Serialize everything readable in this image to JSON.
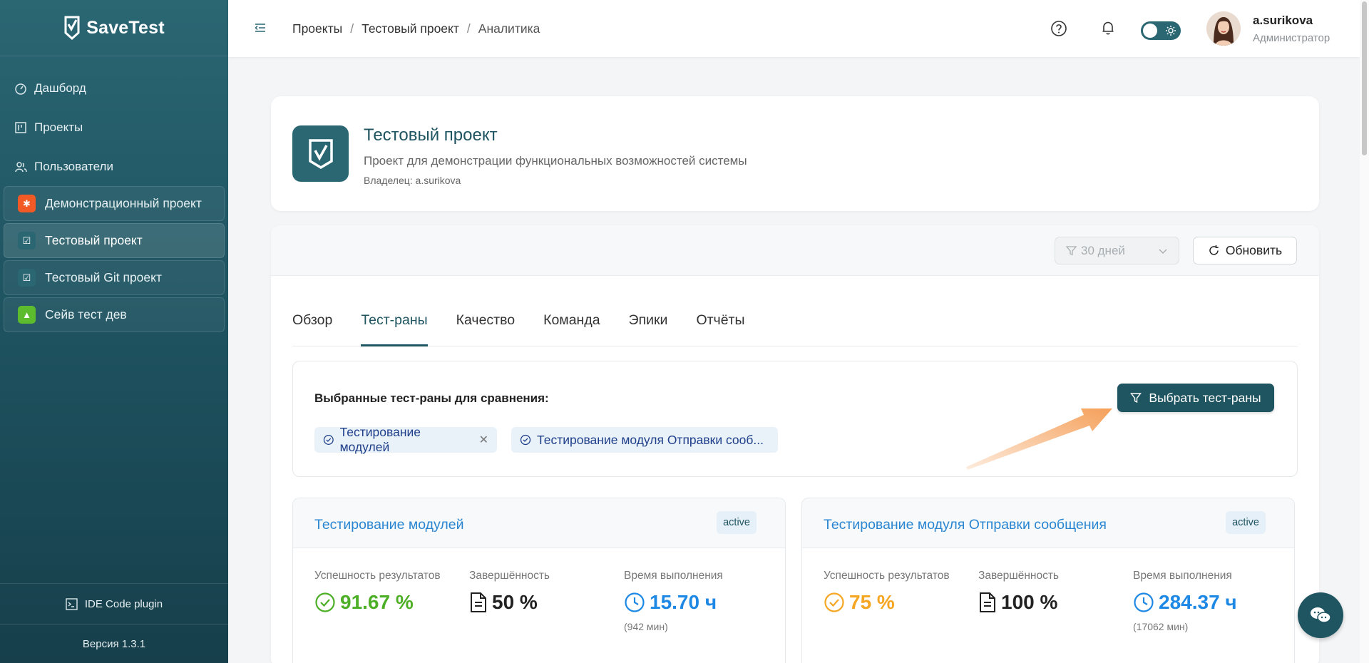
{
  "app": {
    "name": "SaveTest",
    "version": "Версия 1.3.1",
    "ide_plugin": "IDE Code plugin"
  },
  "sidebar": {
    "nav": [
      {
        "label": "Дашборд",
        "icon": "dashboard-icon"
      },
      {
        "label": "Проекты",
        "icon": "kanban-icon"
      },
      {
        "label": "Пользователи",
        "icon": "users-icon"
      }
    ],
    "projects": [
      {
        "label": "Демонстрационный проект",
        "icon": "bug-icon",
        "color": "#f15a24"
      },
      {
        "label": "Тестовый проект",
        "icon": "checklist-icon",
        "color": "#2b6673"
      },
      {
        "label": "Тестовый Git проект",
        "icon": "checklist-icon",
        "color": "#2b6673"
      },
      {
        "label": "Сейв тест дев",
        "icon": "rocket-icon",
        "color": "#5dbb2e"
      }
    ]
  },
  "breadcrumb": {
    "item1": "Проекты",
    "item2": "Тестовый проект",
    "current": "Аналитика",
    "sep": "/"
  },
  "user": {
    "name": "a.surikova",
    "role": "Администратор"
  },
  "project": {
    "title": "Тестовый проект",
    "description": "Проект для демонстрации функциональных возможностей системы",
    "owner": "Владелец: a.surikova"
  },
  "toolbar": {
    "period": "30 дней",
    "refresh": "Обновить"
  },
  "tabs": [
    "Обзор",
    "Тест-раны",
    "Качество",
    "Команда",
    "Эпики",
    "Отчёты"
  ],
  "compare": {
    "label": "Выбранные тест-раны для сравнения:",
    "select_button": "Выбрать тест-раны",
    "chips": [
      "Тестирование модулей",
      "Тестирование модуля Отправки сооб..."
    ]
  },
  "runs": [
    {
      "title": "Тестирование модулей",
      "status": "active",
      "success_label": "Успешность результатов",
      "success_value": "91.67 %",
      "completion_label": "Завершённость",
      "completion_value": "50 %",
      "time_label": "Время выполнения",
      "time_value": "15.70 ч",
      "time_sub": "(942 мин)"
    },
    {
      "title": "Тестирование модуля Отправки сообщения",
      "status": "active",
      "success_label": "Успешность результатов",
      "success_value": "75 %",
      "completion_label": "Завершённость",
      "completion_value": "100 %",
      "time_label": "Время выполнения",
      "time_value": "284.37 ч",
      "time_sub": "(17062 мин)"
    }
  ],
  "colors": {
    "primary": "#1f5461",
    "link": "#2a86d1",
    "success": "#4caf25",
    "warning": "#f5a623",
    "accent_arrow": "#f5a05a"
  }
}
